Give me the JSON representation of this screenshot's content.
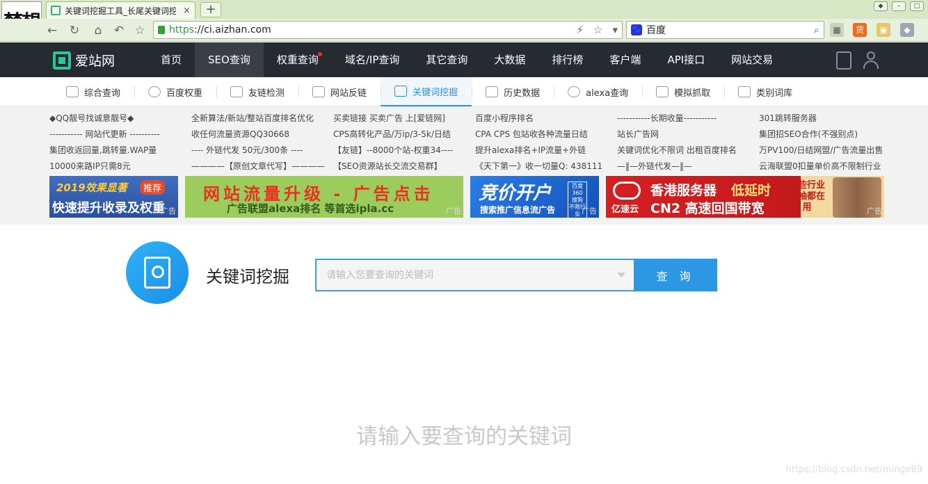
{
  "browser": {
    "profile_logo": "梦想",
    "tab_title": "关键词挖掘工具_长尾关键词挖",
    "tab_close": "×",
    "new_tab": "+",
    "url_https": "https",
    "url_rest": "://ci.aizhan.com",
    "search_engine": "百度",
    "ext_badge": "货"
  },
  "site": {
    "logo_text": "爱站网",
    "nav": [
      "首页",
      "SEO查询",
      "权重查询",
      "域名/IP查询",
      "其它查询",
      "大数据",
      "排行榜",
      "客户端",
      "API接口",
      "网站交易"
    ],
    "nav_active_index": 1
  },
  "subnav": [
    "综合查询",
    "百度权重",
    "友链检测",
    "网站反链",
    "关键词挖掘",
    "历史数据",
    "alexa查询",
    "模拟抓取",
    "类别词库"
  ],
  "subnav_active_index": 4,
  "ad_links": [
    [
      "◆QQ靓号找诚意靓号◆",
      "----------- 网站代更新 ----------",
      "集团收返回量,跳转量.WAP量",
      "10000来路IP只需8元"
    ],
    [
      "全新算法/新站/整站百度排名优化",
      "收任何流量资源QQ30668",
      "---- 外链代发 50元/300条 ----",
      "————【原创文章代写】————"
    ],
    [
      "买卖链接 买卖广告 上[爱链网]",
      "CPS高转化产品/万ip/3-5k/日结",
      "【友链】--8000个站-权重34----",
      "【SEO资源站长交流交易群】"
    ],
    [
      "百度小程序排名",
      "CPA CPS 包站收各种流量日结",
      "提升alexa排名+IP流量+外链",
      "《天下第一》收一切量Q: 438111"
    ],
    [
      "-----------长期收量-----------",
      "站长广告网",
      "关键词优化不限词 出租百度排名",
      "—‖—外链代发—‖—"
    ],
    [
      "301跳转服务器",
      "集团招SEO合作(不强别点)",
      "万PV100/日结网盟/广告流量出售",
      "云海联盟0扣量单价高不限制行业"
    ]
  ],
  "banners": {
    "b1_line1": "2019效果显著",
    "b1_badge": "推荐",
    "b1_line2": "快速提升收录及权重",
    "b2_line1": "网站流量升级 - 广告点击",
    "b2_line2": "广告联盟alexa排名 等首选ipla.cc",
    "b3_line1": "竞价开户",
    "b3_side": "百度 360 搜狗 不限行业",
    "b3_line2": "搜索推广信息流广告",
    "b4_brand": "亿速云",
    "b4_line1a": "香港服务器",
    "b4_line1b": "低延时",
    "b4_line2": "CN2 高速回国带宽",
    "b4_side": "这些行业领袖都在用",
    "ad_tag": "广告"
  },
  "tool": {
    "title": "关键词挖掘",
    "input_placeholder": "请输入您要查询的关键词",
    "button_label": "查 询",
    "empty_hint": "请输入要查询的关键词"
  },
  "watermark": "https://blog.csdn.net/minge89"
}
